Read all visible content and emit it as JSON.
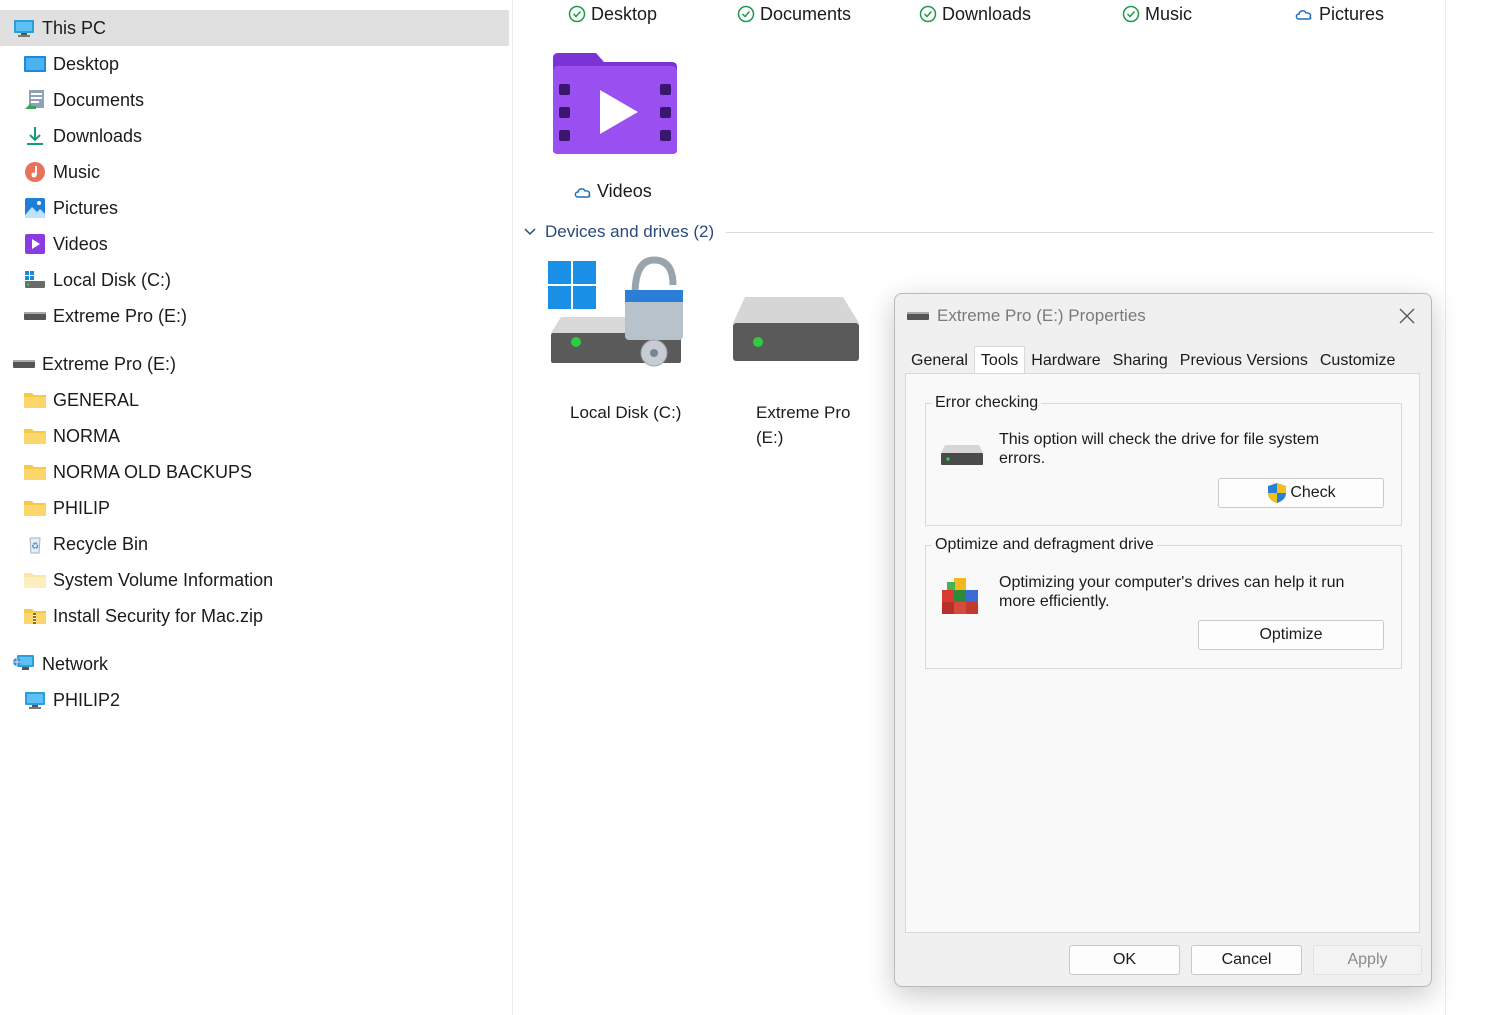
{
  "sidebar": {
    "items": [
      {
        "label": "This PC",
        "icon": "pc-icon",
        "selected": true
      },
      {
        "label": "Desktop",
        "icon": "desktop-icon"
      },
      {
        "label": "Documents",
        "icon": "documents-icon"
      },
      {
        "label": "Downloads",
        "icon": "downloads-icon"
      },
      {
        "label": "Music",
        "icon": "music-icon"
      },
      {
        "label": "Pictures",
        "icon": "pictures-icon"
      },
      {
        "label": "Videos",
        "icon": "videos-icon"
      },
      {
        "label": "Local Disk (C:)",
        "icon": "local-disk-icon"
      },
      {
        "label": "Extreme Pro (E:)",
        "icon": "drive-icon"
      },
      {
        "label": "Extreme Pro (E:)",
        "icon": "drive-icon"
      },
      {
        "label": "GENERAL",
        "icon": "folder-icon"
      },
      {
        "label": "NORMA",
        "icon": "folder-icon"
      },
      {
        "label": "NORMA OLD BACKUPS",
        "icon": "folder-icon"
      },
      {
        "label": "PHILIP",
        "icon": "folder-icon"
      },
      {
        "label": "Recycle Bin",
        "icon": "recycle-bin-icon"
      },
      {
        "label": "System Volume Information",
        "icon": "folder-icon"
      },
      {
        "label": "Install Security for Mac.zip",
        "icon": "zip-folder-icon"
      },
      {
        "label": "Network",
        "icon": "network-icon"
      },
      {
        "label": "PHILIP2",
        "icon": "pc-icon"
      }
    ]
  },
  "main": {
    "quick_access": [
      {
        "label": "Desktop",
        "status": "synced-check-icon"
      },
      {
        "label": "Documents",
        "status": "synced-check-icon"
      },
      {
        "label": "Downloads",
        "status": "synced-check-icon"
      },
      {
        "label": "Music",
        "status": "synced-check-icon"
      },
      {
        "label": "Pictures",
        "status": "cloud-icon"
      }
    ],
    "videos_label": "Videos",
    "devices_group_title": "Devices and drives (2)",
    "drives": [
      {
        "label": "Local Disk (C:)"
      },
      {
        "label_line1": "Extreme Pro",
        "label_line2": "(E:)"
      }
    ]
  },
  "dialog": {
    "title": "Extreme Pro (E:) Properties",
    "tabs": [
      "General",
      "Tools",
      "Hardware",
      "Sharing",
      "Previous Versions",
      "Customize"
    ],
    "active_tab": "Tools",
    "error_checking": {
      "title": "Error checking",
      "text": "This option will check the drive for file system errors.",
      "button": "Check"
    },
    "optimize": {
      "title": "Optimize and defragment drive",
      "text": "Optimizing your computer's drives can help it run more efficiently.",
      "button": "Optimize"
    },
    "buttons": {
      "ok": "OK",
      "cancel": "Cancel",
      "apply": "Apply"
    }
  },
  "colors": {
    "accent": "#0078d4",
    "selected_row": "#e0e0e0",
    "video_purple": "#8a3ce0",
    "drive_gray": "#6b6b6b",
    "led_green": "#2ecc40",
    "folder_yellow": "#f7c948"
  }
}
